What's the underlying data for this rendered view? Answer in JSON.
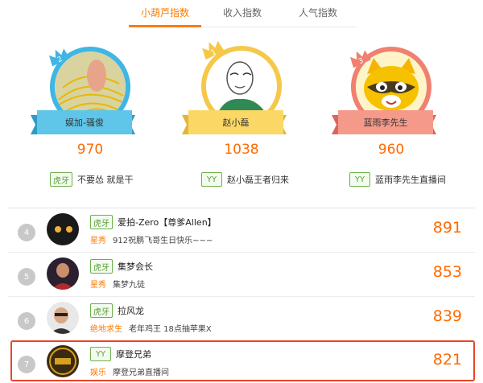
{
  "tabs": [
    {
      "label": "小葫芦指数",
      "active": true
    },
    {
      "label": "收入指数",
      "active": false
    },
    {
      "label": "人气指数",
      "active": false
    }
  ],
  "accent_color": "#ff7a00",
  "top3": [
    {
      "rank": "2",
      "name": "娱加-骚俊",
      "score": "970",
      "platform": "虎牙",
      "room": "不要怂 就是干",
      "color": "#3fb6e3"
    },
    {
      "rank": "1",
      "name": "赵小磊",
      "score": "1038",
      "platform": "YY",
      "room": "赵小磊王者归来",
      "color": "#f5c84a"
    },
    {
      "rank": "3",
      "name": "蓝雨李先生",
      "score": "960",
      "platform": "YY",
      "room": "蓝雨李先生直播间",
      "color": "#f08070"
    }
  ],
  "list": [
    {
      "rank": "4",
      "platform": "虎牙",
      "name": "爱拍-Zero【尊爹Allen】",
      "category": "星秀",
      "room": "912祝鹏飞哥生日快乐~~~",
      "score": "891"
    },
    {
      "rank": "5",
      "platform": "虎牙",
      "name": "集梦会长",
      "category": "星秀",
      "room": "集梦九徒",
      "score": "853"
    },
    {
      "rank": "6",
      "platform": "虎牙",
      "name": "拉风龙",
      "category": "绝地求生",
      "room": "老年鸡王 18点抽苹果X",
      "score": "839"
    },
    {
      "rank": "7",
      "platform": "YY",
      "name": "摩登兄弟",
      "category": "娱乐",
      "room": "摩登兄弟直播间",
      "score": "821",
      "highlighted": true
    }
  ]
}
